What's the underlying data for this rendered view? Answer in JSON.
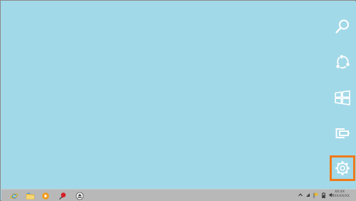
{
  "screen": {
    "background_color": "#a2d9e8",
    "accent_color": "#ef7a1a"
  },
  "charms": [
    {
      "name": "Search",
      "icon": "search-icon"
    },
    {
      "name": "Share",
      "icon": "share-icon"
    },
    {
      "name": "Start",
      "icon": "windows-logo-icon"
    },
    {
      "name": "Devices",
      "icon": "devices-icon"
    },
    {
      "name": "Settings",
      "icon": "gear-icon",
      "selected": true
    }
  ],
  "taskbar": {
    "pinned_apps": [
      {
        "icon": "internet-explorer-icon"
      },
      {
        "icon": "file-explorer-icon"
      },
      {
        "icon": "media-player-icon"
      },
      {
        "icon": "pushpin-app-icon"
      },
      {
        "icon": "eject-icon"
      }
    ],
    "tray_icons": [
      "chevron-up-icon",
      "network-icon",
      "flag-icon",
      "battery-icon",
      "speaker-icon"
    ],
    "clock": {
      "time": "XX:XX",
      "date": "XXXX/XX/XX"
    }
  }
}
